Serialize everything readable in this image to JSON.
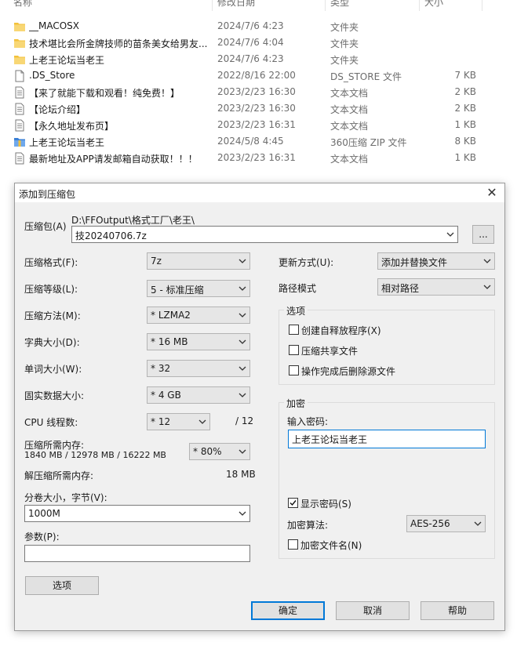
{
  "file_list": {
    "columns": {
      "name": "名称",
      "date": "修改日期",
      "type": "类型",
      "size": "大小"
    },
    "rows": [
      {
        "icon": "folder-icon",
        "name": "__MACOSX",
        "date": "2024/7/6 4:23",
        "type": "文件夹",
        "size": ""
      },
      {
        "icon": "folder-icon",
        "name": "技术堪比会所金牌技师的苗条美女给男友...",
        "date": "2024/7/6 4:04",
        "type": "文件夹",
        "size": ""
      },
      {
        "icon": "folder-icon",
        "name": "上老王论坛当老王",
        "date": "2024/7/6 4:23",
        "type": "文件夹",
        "size": ""
      },
      {
        "icon": "blank-file-icon",
        "name": ".DS_Store",
        "date": "2022/8/16 22:00",
        "type": "DS_STORE 文件",
        "size": "7 KB"
      },
      {
        "icon": "text-file-icon",
        "name": "【来了就能下载和观看！纯免费！】",
        "date": "2023/2/23 16:30",
        "type": "文本文档",
        "size": "2 KB"
      },
      {
        "icon": "text-file-icon",
        "name": "【论坛介绍】",
        "date": "2023/2/23 16:30",
        "type": "文本文档",
        "size": "2 KB"
      },
      {
        "icon": "text-file-icon",
        "name": "【永久地址发布页】",
        "date": "2023/2/23 16:31",
        "type": "文本文档",
        "size": "1 KB"
      },
      {
        "icon": "zip-file-icon",
        "name": "上老王论坛当老王",
        "date": "2024/5/8 4:45",
        "type": "360压缩 ZIP 文件",
        "size": "8 KB"
      },
      {
        "icon": "text-file-icon",
        "name": "最新地址及APP请发邮箱自动获取！！！",
        "date": "2023/2/23 16:31",
        "type": "文本文档",
        "size": "1 KB"
      }
    ]
  },
  "dialog": {
    "title": "添加到压缩包",
    "archive": {
      "label": "压缩包(A)",
      "path": "D:\\FFOutput\\格式工厂\\老王\\",
      "filename": "技20240706.7z",
      "browse_label": "..."
    },
    "left": {
      "format": {
        "label": "压缩格式(F):",
        "value": "7z"
      },
      "level": {
        "label": "压缩等级(L):",
        "value": "5 - 标准压缩"
      },
      "method": {
        "label": "压缩方法(M):",
        "value": "* LZMA2"
      },
      "dict": {
        "label": "字典大小(D):",
        "value": "* 16 MB"
      },
      "word": {
        "label": "单词大小(W):",
        "value": "* 32"
      },
      "solid": {
        "label": "固实数据大小:",
        "value": "* 4 GB"
      },
      "threads": {
        "label": "CPU 线程数:",
        "value": "* 12",
        "max": "/ 12"
      },
      "mem_compress": {
        "label": "压缩所需内存:",
        "detail": "1840 MB / 12978 MB / 16222 MB",
        "value": "* 80%"
      },
      "mem_decompress": {
        "label": "解压缩所需内存:",
        "value": "18 MB"
      },
      "volume": {
        "label": "分卷大小，字节(V):",
        "value": "1000M"
      },
      "params": {
        "label": "参数(P):",
        "value": ""
      },
      "options_button": "选项"
    },
    "right": {
      "update": {
        "label": "更新方式(U):",
        "value": "添加并替换文件"
      },
      "path_mode": {
        "label": "路径模式",
        "value": "相对路径"
      },
      "options": {
        "title": "选项",
        "sfx": {
          "label": "创建自释放程序(X)",
          "checked": false
        },
        "shared": {
          "label": "压缩共享文件",
          "checked": false
        },
        "delete": {
          "label": "操作完成后删除源文件",
          "checked": false
        }
      },
      "encryption": {
        "title": "加密",
        "password_label": "输入密码:",
        "password_value": "上老王论坛当老王",
        "show_password": {
          "label": "显示密码(S)",
          "checked": true
        },
        "method_label": "加密算法:",
        "method_value": "AES-256",
        "encrypt_names": {
          "label": "加密文件名(N)",
          "checked": false
        }
      }
    },
    "buttons": {
      "ok": "确定",
      "cancel": "取消",
      "help": "帮助"
    }
  },
  "colors": {
    "accent": "#0078d7",
    "dialog_bg": "#f0f0f0",
    "folder": "#f3c13a"
  }
}
